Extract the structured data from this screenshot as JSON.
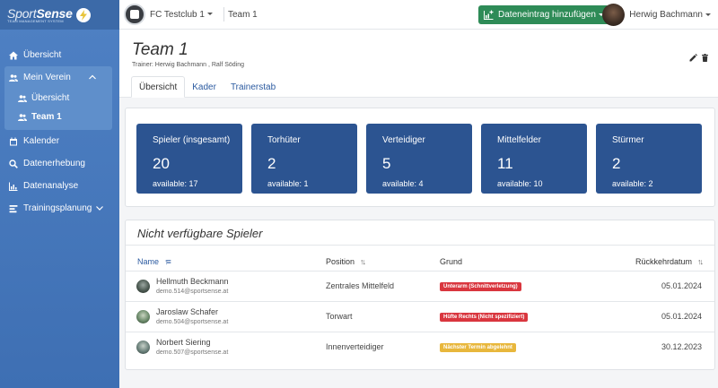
{
  "brand": {
    "name_a": "Sport",
    "name_b": "Sense",
    "tagline": "TEAM MANAGEMENT SYSTEM"
  },
  "sidebar": {
    "items": [
      {
        "label": "Übersicht",
        "icon": "home-icon"
      },
      {
        "label": "Mein Verein",
        "icon": "users-icon",
        "subitems": [
          {
            "label": "Übersicht"
          },
          {
            "label": "Team 1"
          }
        ]
      },
      {
        "label": "Kalender",
        "icon": "calendar-icon"
      },
      {
        "label": "Datenerhebung",
        "icon": "search-icon"
      },
      {
        "label": "Datenanalyse",
        "icon": "chart-icon"
      },
      {
        "label": "Trainingsplanung",
        "icon": "bars-icon"
      }
    ]
  },
  "topbar": {
    "club": "FC Testclub 1",
    "team": "Team 1",
    "add_button": "Dateneintrag hinzufügen",
    "user": "Herwig Bachmann"
  },
  "header": {
    "title": "Team 1",
    "trainer": "Trainer: Herwig Bachmann ,  Ralf Söding",
    "tabs": [
      "Übersicht",
      "Kader",
      "Trainerstab"
    ]
  },
  "stats": [
    {
      "label": "Spieler (insgesamt)",
      "value": "20",
      "available": "available: 17"
    },
    {
      "label": "Torhüter",
      "value": "2",
      "available": "available: 1"
    },
    {
      "label": "Verteidiger",
      "value": "5",
      "available": "available: 4"
    },
    {
      "label": "Mittelfelder",
      "value": "11",
      "available": "available: 10"
    },
    {
      "label": "Stürmer",
      "value": "2",
      "available": "available: 2"
    }
  ],
  "unavailable": {
    "title": "Nicht verfügbare Spieler",
    "columns": [
      "Name",
      "Position",
      "Grund",
      "Rückkehrdatum"
    ],
    "rows": [
      {
        "name": "Hellmuth Beckmann",
        "email": "demo.514@sportsense.at",
        "position": "Zentrales Mittelfeld",
        "reason": "Unterarm (Schnittverletzung)",
        "reason_color": "#d9363e",
        "date": "05.01.2024"
      },
      {
        "name": "Jaroslaw Schafer",
        "email": "demo.504@sportsense.at",
        "position": "Torwart",
        "reason": "Hüfte Rechts (Nicht spezifiziert)",
        "reason_color": "#d9363e",
        "date": "05.01.2024"
      },
      {
        "name": "Norbert Siering",
        "email": "demo.507@sportsense.at",
        "position": "Innenverteidiger",
        "reason": "Nächster Termin abgelehnt",
        "reason_color": "#e8b73c",
        "date": "30.12.2023"
      }
    ]
  }
}
